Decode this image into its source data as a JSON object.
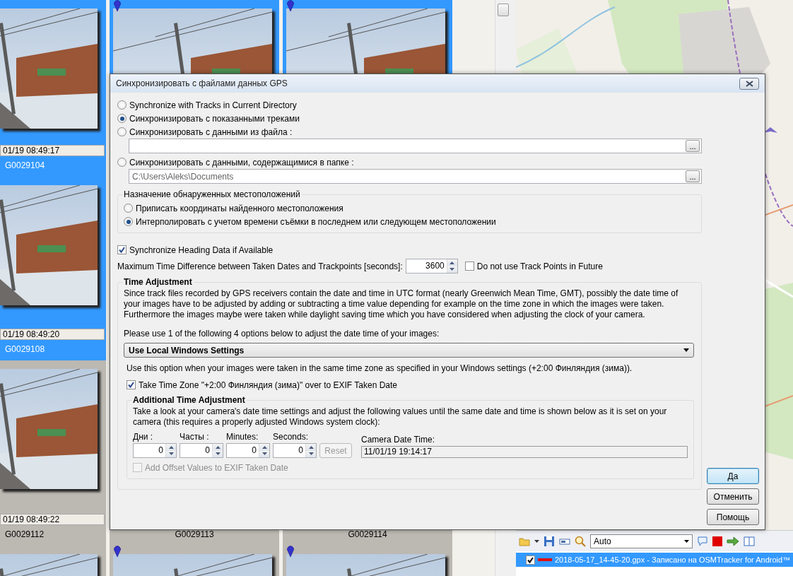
{
  "thumbnail_rows": [
    [
      {
        "selected": true,
        "pinned": false,
        "date": "01/19 08:49:17",
        "name": "G0029104"
      },
      {
        "selected": true,
        "pinned": true
      },
      {
        "selected": true,
        "pinned": true
      }
    ],
    [
      {
        "selected": true,
        "pinned": false,
        "date": "01/19 08:49:20",
        "name": "G0029108"
      }
    ],
    [
      {
        "selected": false,
        "pinned": false,
        "date": "01/19 08:49:22",
        "name": "G0029112"
      },
      {
        "selected": false,
        "pinned": false,
        "name": "G0029113"
      },
      {
        "selected": false,
        "pinned": false,
        "name": "G0029114"
      }
    ],
    [
      {
        "selected": false,
        "pinned": false
      },
      {
        "selected": false,
        "pinned": true
      },
      {
        "selected": false,
        "pinned": true
      }
    ]
  ],
  "dialog": {
    "title": "Синхронизировать с файлами данных GPS",
    "sources": [
      {
        "kind": "plain",
        "label": "Synchronize with Tracks in Current Directory",
        "selected": false
      },
      {
        "kind": "plain",
        "label": "Синхронизировать с показанными треками",
        "selected": true
      },
      {
        "kind": "path",
        "label": "Синхронизировать с данными из файла :",
        "selected": false,
        "browse": "..."
      },
      {
        "kind": "path",
        "label": "Синхронизировать с данными, содержащимися в папке :",
        "selected": false,
        "value": "C:\\Users\\Aleks\\Documents",
        "browse": "..."
      }
    ],
    "assignment": {
      "title": "Назначение обнаруженных местоположений",
      "options": [
        {
          "label": "Приписать координаты найденного местоположения",
          "selected": false
        },
        {
          "label": "Интерполировать с учетом времени съёмки в последнем или следующем местоположении",
          "selected": true
        }
      ]
    },
    "heading_checkbox": {
      "label": "Synchronize Heading Data if Available",
      "checked": true
    },
    "max_difference": {
      "label": "Maximum Time Difference between Taken Dates and Trackpoints [seconds]:",
      "value": "3600"
    },
    "future_checkbox": {
      "label": "Do not use Track Points in Future",
      "checked": false
    },
    "time_adjustment": {
      "title": "Time Adjustment",
      "description": "Since track files recorded by GPS receivers contain the date and time in UTC format (nearly Greenwich Mean Time, GMT), possibly the date time of your images have to be adjusted by adding or subtracting a time value depending for example on the time zone in which the images were taken. Furthermore the images maybe were taken while daylight saving time which you have considered when adjusting the clock of your camera.",
      "prompt": "Please use 1 of the following 4 options below to adjust the date time of your images:",
      "mode": "Use Local Windows Settings",
      "note": "Use this option when your images were taken in the same time zone as specified in your Windows settings (+2:00 Финляндия (зима)).",
      "timezone_checkbox": {
        "label": "Take Time Zone \"+2:00 Финляндия (зима)\" over to EXIF Taken Date",
        "checked": true
      },
      "additional": {
        "title": "Additional Time Adjustment",
        "description": "Take a look at your camera's date time settings and adjust the following values until the same date and time is shown below as it is  set on your camera (this requires a properly adjusted Windows system clock):",
        "offsets": [
          {
            "label": "Дни :",
            "value": "0"
          },
          {
            "label": "Часты :",
            "value": "0"
          },
          {
            "label": "Minutes:",
            "value": "0"
          },
          {
            "label": "Seconds:",
            "value": "0"
          }
        ],
        "reset_button": {
          "label": "Reset",
          "disabled": true
        },
        "camera_label": "Camera Date Time:",
        "camera_value": "11/01/19 19:14:17",
        "offset_checkbox": {
          "label": "Add Offset Values to EXIF Taken Date",
          "checked": false,
          "disabled": true
        }
      }
    },
    "buttons": [
      {
        "label": "Да",
        "default": true
      },
      {
        "label": "Отменить",
        "default": false
      },
      {
        "label": "Помощь",
        "default": false
      }
    ]
  },
  "toolbar": {
    "zoom": "Auto"
  },
  "tracks": [
    {
      "label": "2018-05-17_14-45-20.gpx - Записано на OSMTracker for Android™",
      "checked": true,
      "selected": true,
      "color": "#e01010"
    }
  ]
}
